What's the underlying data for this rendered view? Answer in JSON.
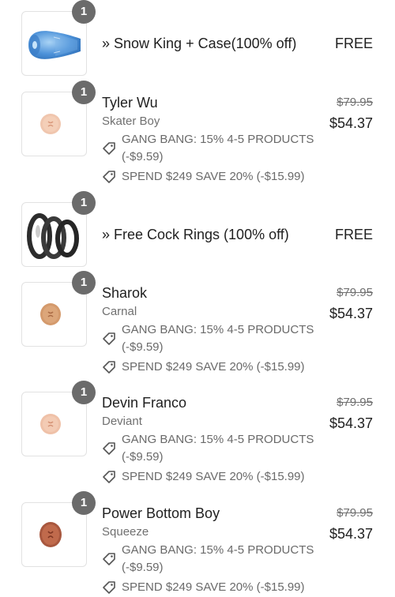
{
  "icons": {
    "quantity_badge": "quantity-badge",
    "discount_tag": "tag-icon"
  },
  "items": [
    {
      "kind": "free",
      "quantity": "1",
      "label": "» Snow King + Case(100% off)",
      "price": "FREE",
      "image": "blue-stroker-case-thumbnail"
    },
    {
      "kind": "product",
      "quantity": "1",
      "name": "Tyler Wu",
      "variant": "Skater Boy",
      "original_price": "$79.95",
      "price": "$54.37",
      "image": "light-skin-product-thumbnail",
      "discounts": [
        {
          "line1": "GANG BANG: 15% 4-5 PRODUCTS",
          "line2": "(-$9.59)"
        },
        {
          "line1": "SPEND $249 SAVE 20% (-$15.99)"
        }
      ]
    },
    {
      "kind": "free",
      "quantity": "1",
      "label": "» Free Cock Rings (100% off)",
      "price": "FREE",
      "image": "black-rings-thumbnail"
    },
    {
      "kind": "product",
      "quantity": "1",
      "name": "Sharok",
      "variant": "Carnal",
      "original_price": "$79.95",
      "price": "$54.37",
      "image": "tan-skin-product-thumbnail",
      "discounts": [
        {
          "line1": "GANG BANG: 15% 4-5 PRODUCTS",
          "line2": "(-$9.59)"
        },
        {
          "line1": "SPEND $249 SAVE 20% (-$15.99)"
        }
      ]
    },
    {
      "kind": "product",
      "quantity": "1",
      "name": "Devin Franco",
      "variant": "Deviant",
      "original_price": "$79.95",
      "price": "$54.37",
      "image": "light-skin-product-thumbnail",
      "discounts": [
        {
          "line1": "GANG BANG: 15% 4-5 PRODUCTS",
          "line2": "(-$9.59)"
        },
        {
          "line1": "SPEND $249 SAVE 20% (-$15.99)"
        }
      ]
    },
    {
      "kind": "product",
      "quantity": "1",
      "name": "Power Bottom Boy",
      "variant": "Squeeze",
      "original_price": "$79.95",
      "price": "$54.37",
      "image": "dark-skin-product-thumbnail",
      "discounts": [
        {
          "line1": "GANG BANG: 15% 4-5 PRODUCTS",
          "line2": "(-$9.59)"
        },
        {
          "line1": "SPEND $249 SAVE 20% (-$15.99)"
        }
      ]
    }
  ],
  "colors": {
    "text": "#1f1f1f",
    "muted_text": "#707070",
    "badge": "#6b6b6b",
    "thumb_border": "#e2e2e2"
  }
}
